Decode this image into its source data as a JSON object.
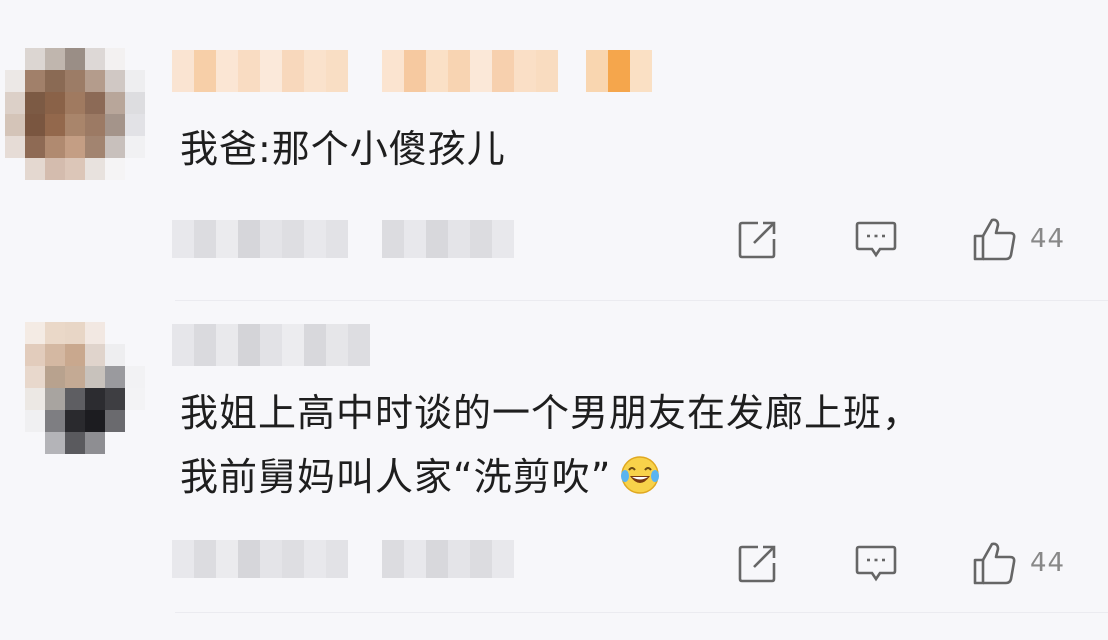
{
  "comments": [
    {
      "text_lines": [
        "我爸:那个小傻孩儿"
      ],
      "likes": "44",
      "actions": {
        "share_icon": "share-icon",
        "reply_icon": "comment-icon",
        "like_icon": "thumbs-up-icon"
      }
    },
    {
      "text_lines": [
        "我姐上高中时谈的一个男朋友在发廊上班，",
        "我前舅妈叫人家“洗剪吹”"
      ],
      "emoji": "laughing-crying-emoji",
      "likes": "44",
      "actions": {
        "share_icon": "share-icon",
        "reply_icon": "comment-icon",
        "like_icon": "thumbs-up-icon"
      }
    }
  ],
  "colors": {
    "background": "#f7f7fa",
    "name_blur_orange": "#f5c9a0",
    "icon_gray": "#666666",
    "count_gray": "#888888"
  }
}
